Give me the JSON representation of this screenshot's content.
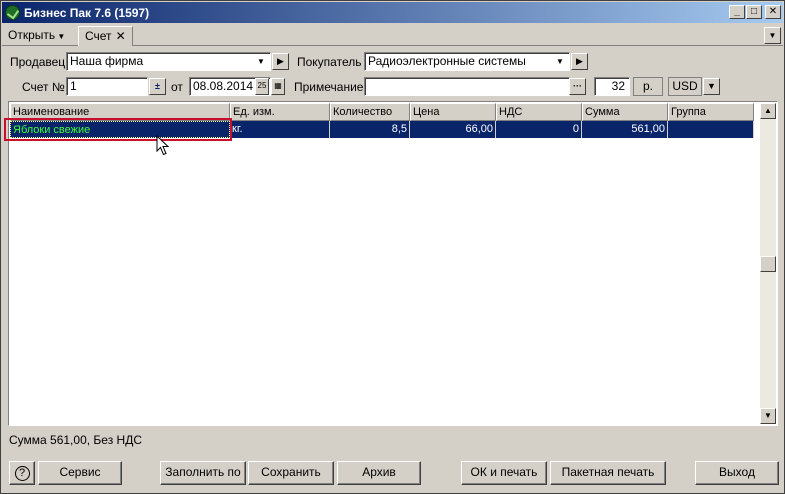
{
  "window": {
    "title": "Бизнес Пак 7.6 (1597)",
    "buttons": [
      "_",
      "□",
      "✕"
    ]
  },
  "tabstrip": {
    "open_menu": "Открыть",
    "active_tab": "Счет",
    "close_glyph": "✕"
  },
  "form": {
    "seller_label": "Продавец",
    "seller_value": "Наша фирма",
    "buyer_label": "Покупатель",
    "buyer_value": "Радиоэлектронные системы",
    "invoice_label": "Счет №",
    "invoice_value": "1",
    "from_label": "от",
    "date_value": "08.08.2014",
    "note_label": "Примечание",
    "note_value": "",
    "rate_value": "32",
    "rate_unit": "р.",
    "currency": "USD"
  },
  "grid": {
    "columns": [
      "Наименование",
      "Ед. изм.",
      "Количество",
      "Цена",
      "НДС",
      "Сумма",
      "Группа"
    ],
    "rows": [
      [
        "Яблоки свежие",
        "кг.",
        "8,5",
        "66,00",
        "0",
        "561,00",
        ""
      ]
    ]
  },
  "status_text": "Сумма 561,00, Без НДС",
  "buttons": {
    "help": "?",
    "service": "Сервис",
    "fill_by": "Заполнить по",
    "save": "Сохранить",
    "archive": "Архив",
    "ok_print": "ОК и печать",
    "batch_print": "Пакетная печать",
    "exit": "Выход"
  },
  "colors": {
    "title_bar": "#0a246a",
    "selection": "#0a246a",
    "selected_text": "#3cff3c",
    "highlight_box": "#c8102e"
  }
}
